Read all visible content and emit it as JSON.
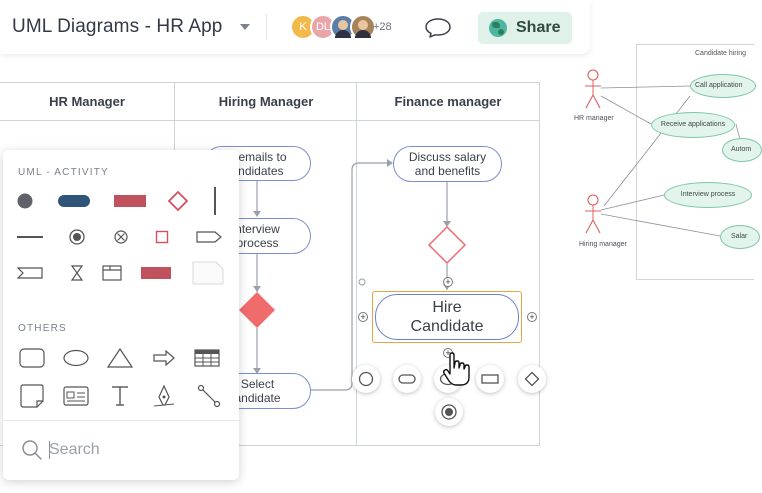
{
  "topbar": {
    "title": "UML Diagrams - HR App",
    "avatars": [
      {
        "initial": "K",
        "color": "#f2b94b"
      },
      {
        "initial": "DL",
        "color": "#e9a5a8"
      }
    ],
    "collaborator_count": "+28",
    "share_label": "Share"
  },
  "lanes": {
    "headers": [
      "HR Manager",
      "Hiring Manager",
      "Finance manager"
    ]
  },
  "diagram": {
    "nodes": {
      "send_emails": [
        "d emails to",
        "andidates"
      ],
      "interview": [
        "nterview",
        "process"
      ],
      "select": [
        "Select",
        "andidate"
      ],
      "discuss": [
        "Discuss salary",
        "and benefits"
      ],
      "hire": [
        "Hire",
        "Candidate"
      ]
    },
    "colors": {
      "node_border": "#7b8fd2",
      "decision_fill": "#f06b6b",
      "selection": "#e6a541"
    }
  },
  "palette": {
    "section_activity": "UML - ACTIVITY",
    "section_others": "OTHERS",
    "search_placeholder": "Search",
    "activity_items": [
      "initial-node",
      "action-rounded",
      "action-rect",
      "decision",
      "fork-vertical",
      "fork-horizontal",
      "final-node",
      "flow-final",
      "object-node",
      "send-signal",
      "accept-signal",
      "time-event",
      "partition",
      "region",
      "note"
    ],
    "other_items": [
      "rounded-rectangle",
      "ellipse",
      "triangle",
      "arrow",
      "table",
      "sticky-note",
      "card",
      "text",
      "pen",
      "connector"
    ]
  },
  "thumbnail": {
    "title": "Candidate hiring",
    "actors": [
      "HR manager",
      "Hiring manager"
    ],
    "use_cases": [
      "Call application",
      "Receive applications",
      "Autom",
      "Interview process",
      "Salar"
    ]
  }
}
